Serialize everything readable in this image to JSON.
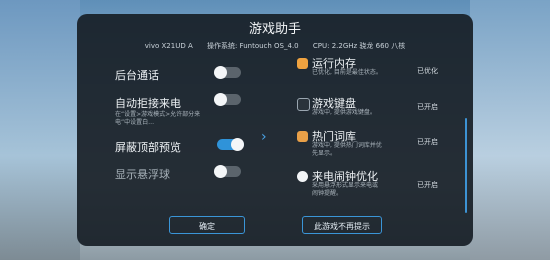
{
  "panel": {
    "title": "游戏助手",
    "device": {
      "model": "vivo X21UD A",
      "os": "操作系统: Funtouch OS_4.0",
      "cpu": "CPU: 2.2GHz 骁龙 660 八核"
    }
  },
  "settings": [
    {
      "label": "后台通话",
      "state": "off",
      "desc": ""
    },
    {
      "label": "自动拒接来电",
      "state": "off",
      "desc": "在“设置>游戏模式>允许部分来电”中设置白…"
    },
    {
      "label": "屏蔽顶部预览",
      "state": "on",
      "desc": ""
    },
    {
      "label": "显示悬浮球",
      "state": "off",
      "desc": ""
    }
  ],
  "features": [
    {
      "title": "运行内存",
      "desc": "已优化, 目前是最佳状态。",
      "status": "已优化",
      "icon": "memory-icon",
      "color": "#f0a340"
    },
    {
      "title": "游戏键盘",
      "desc": "游戏中, 提供游戏键盘。",
      "status": "已开启",
      "icon": "keyboard-icon",
      "color": "#9aa6b0"
    },
    {
      "title": "热门词库",
      "desc": "游戏中, 提供热门词库并优先显示。",
      "status": "已开启",
      "icon": "dictionary-icon",
      "color": "#e9a048"
    },
    {
      "title": "来电闹钟优化",
      "desc": "采用悬浮形式显示来电或闹钟提醒。",
      "status": "已开启",
      "icon": "alarm-icon",
      "color": "#f3f5f7"
    }
  ],
  "buttons": {
    "confirm": "确定",
    "no_prompt": "此游戏不再提示"
  },
  "colors": {
    "accent": "#2f93d9",
    "panel_bg": "#171e26"
  }
}
